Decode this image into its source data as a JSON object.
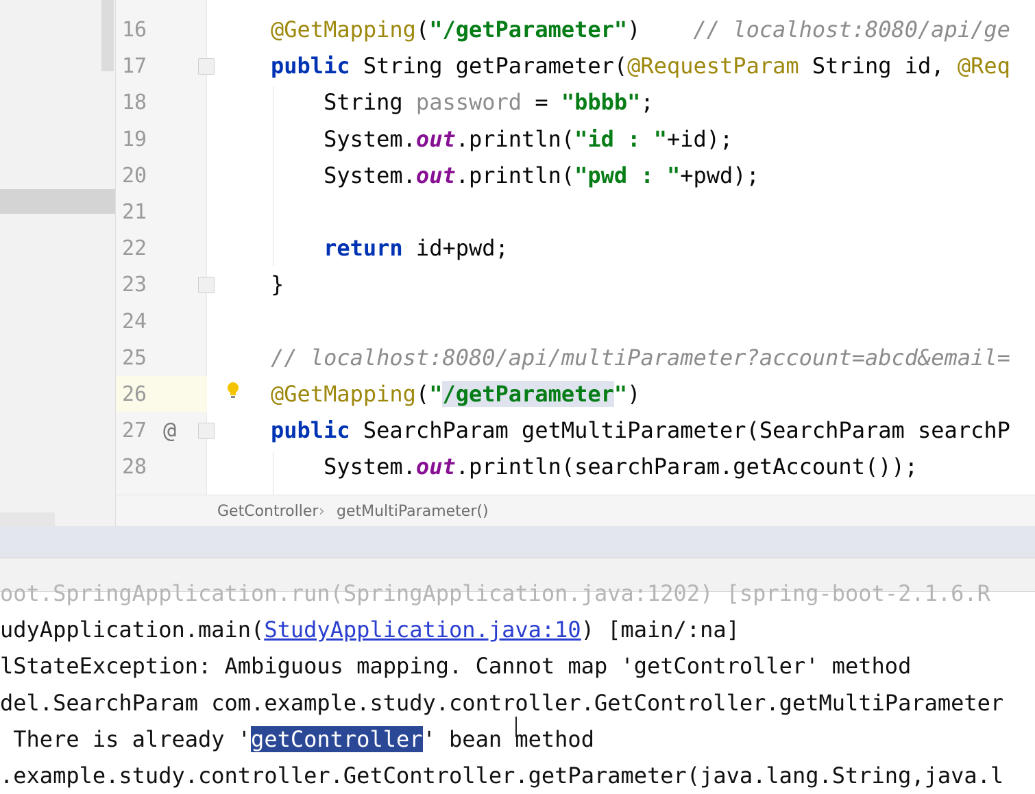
{
  "editor": {
    "lines": [
      {
        "num": "16",
        "parts": [
          {
            "t": "@GetMapping",
            "c": "ann"
          },
          {
            "t": "(",
            "c": ""
          },
          {
            "t": "\"/getParameter\"",
            "c": "str"
          },
          {
            "t": ")    ",
            "c": ""
          },
          {
            "t": "// localhost:8080/api/ge",
            "c": "cmt"
          }
        ]
      },
      {
        "num": "17",
        "parts": [
          {
            "t": "public ",
            "c": "kw"
          },
          {
            "t": "String getParameter(",
            "c": ""
          },
          {
            "t": "@RequestParam",
            "c": "ann"
          },
          {
            "t": " String id, ",
            "c": ""
          },
          {
            "t": "@Req",
            "c": "ann"
          }
        ]
      },
      {
        "num": "18",
        "parts": [
          {
            "t": "    String ",
            "c": ""
          },
          {
            "t": "password",
            "c": "grey"
          },
          {
            "t": " = ",
            "c": ""
          },
          {
            "t": "\"bbbb\"",
            "c": "str"
          },
          {
            "t": ";",
            "c": ""
          }
        ]
      },
      {
        "num": "19",
        "parts": [
          {
            "t": "    System.",
            "c": ""
          },
          {
            "t": "out",
            "c": "fld"
          },
          {
            "t": ".println(",
            "c": ""
          },
          {
            "t": "\"id : \"",
            "c": "str"
          },
          {
            "t": "+id);",
            "c": ""
          }
        ]
      },
      {
        "num": "20",
        "parts": [
          {
            "t": "    System.",
            "c": ""
          },
          {
            "t": "out",
            "c": "fld"
          },
          {
            "t": ".println(",
            "c": ""
          },
          {
            "t": "\"pwd : \"",
            "c": "str"
          },
          {
            "t": "+pwd);",
            "c": ""
          }
        ]
      },
      {
        "num": "21",
        "parts": []
      },
      {
        "num": "22",
        "parts": [
          {
            "t": "    ",
            "c": ""
          },
          {
            "t": "return",
            "c": "kw"
          },
          {
            "t": " id+pwd;",
            "c": ""
          }
        ]
      },
      {
        "num": "23",
        "parts": [
          {
            "t": "}",
            "c": ""
          }
        ]
      },
      {
        "num": "24",
        "parts": []
      },
      {
        "num": "25",
        "parts": [
          {
            "t": "// localhost:8080/api/multiParameter?account=abcd&email=",
            "c": "cmt"
          }
        ]
      },
      {
        "num": "26",
        "parts": [
          {
            "t": "@GetMapping",
            "c": "ann"
          },
          {
            "t": "(",
            "c": ""
          },
          {
            "t": "\"",
            "c": "str"
          },
          {
            "t": "/getParameter",
            "c": "str sel-text"
          },
          {
            "t": "\"",
            "c": "str"
          },
          {
            "t": ")",
            "c": ""
          }
        ]
      },
      {
        "num": "27",
        "parts": [
          {
            "t": "public ",
            "c": "kw"
          },
          {
            "t": "SearchParam getMultiParameter(SearchParam searchP",
            "c": ""
          }
        ]
      },
      {
        "num": "28",
        "parts": [
          {
            "t": "    System.",
            "c": ""
          },
          {
            "t": "out",
            "c": "fld"
          },
          {
            "t": ".println(searchParam.getAccount());",
            "c": ""
          }
        ]
      }
    ]
  },
  "breadcrumb": {
    "class_name": "GetController",
    "separator": "›",
    "method_name": "getMultiParameter()"
  },
  "console": {
    "lines": [
      {
        "parts": [
          {
            "t": "oot.SpringApplication.run(",
            "c": "clipped"
          },
          {
            "t": "SpringApplication.java:1202",
            "c": "clipped"
          },
          {
            "t": ") [spring-boot-2.1.6.R",
            "c": "clipped"
          }
        ]
      },
      {
        "parts": [
          {
            "t": "udyApplication.main(",
            "c": ""
          },
          {
            "t": "StudyApplication.java:10",
            "c": "link"
          },
          {
            "t": ") [main/:na]",
            "c": ""
          }
        ]
      },
      {
        "parts": [
          {
            "t": "lStateException: Ambiguous mapping. Cannot map 'getController' method",
            "c": ""
          }
        ]
      },
      {
        "parts": [
          {
            "t": "del.SearchParam com.example.study.controller.GetController.getMultiParameter",
            "c": ""
          }
        ]
      },
      {
        "parts": [
          {
            "t": " There is already '",
            "c": ""
          },
          {
            "t": "getController",
            "c": "cursor-sel"
          },
          {
            "t": "' bean method",
            "c": ""
          }
        ]
      },
      {
        "parts": [
          {
            "t": ".example.study.controller.GetController.getParameter(java.lang.String,java.l",
            "c": ""
          }
        ]
      }
    ]
  }
}
